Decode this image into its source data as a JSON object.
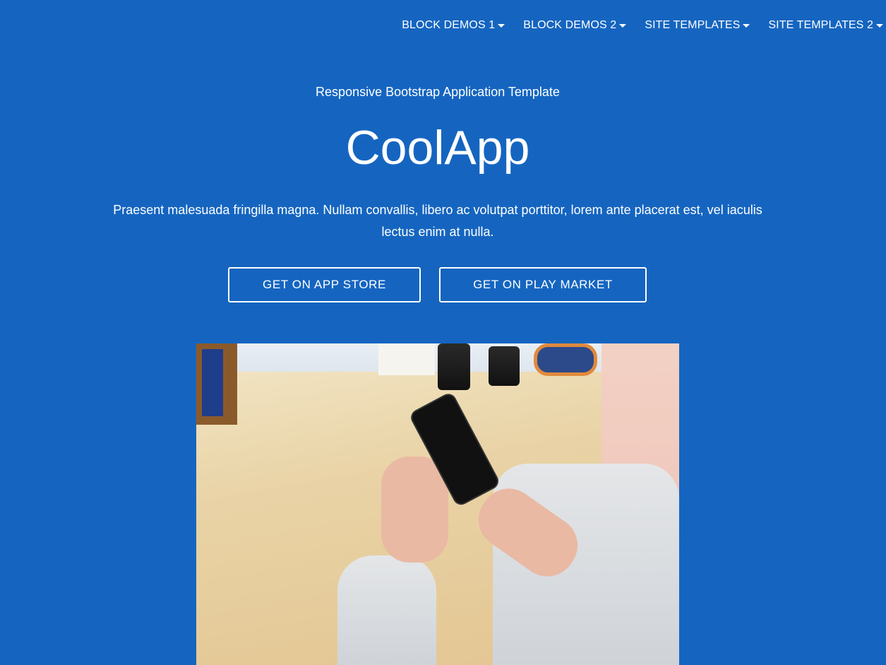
{
  "nav": {
    "items": [
      {
        "label": "BLOCK DEMOS 1"
      },
      {
        "label": "BLOCK DEMOS 2"
      },
      {
        "label": "SITE TEMPLATES"
      },
      {
        "label": "SITE TEMPLATES 2"
      }
    ]
  },
  "hero": {
    "subtitle": "Responsive Bootstrap Application Template",
    "title": "CoolApp",
    "lead": "Praesent malesuada fringilla magna. Nullam convallis, libero ac volutpat porttitor, lorem ante placerat est, vel iaculis lectus enim at nulla.",
    "buttons": {
      "app_store": "GET ON APP STORE",
      "play_market": "GET ON PLAY MARKET"
    }
  },
  "colors": {
    "background": "#1565c0",
    "text": "#ffffff"
  }
}
